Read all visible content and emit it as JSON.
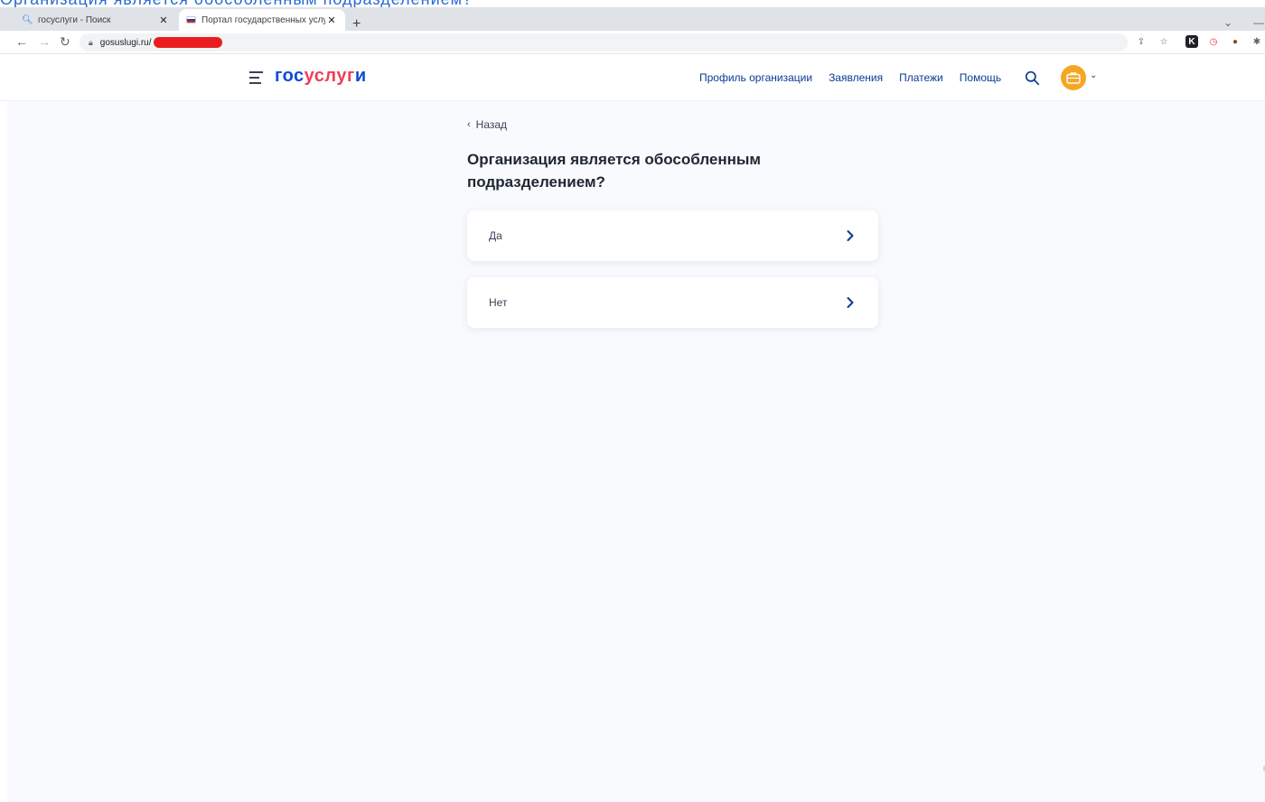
{
  "cropped_header_text": "Организация является обособленным подразделением?",
  "browser": {
    "tabs": [
      {
        "title": "госуслуги - Поиск",
        "icon": "search-icon",
        "active": false
      },
      {
        "title": "Портал государственных услуг",
        "icon": "russian-flag-icon",
        "active": true
      }
    ],
    "url": "gosuslugi.ru/"
  },
  "site": {
    "logo": {
      "part1": "гос",
      "part2": "услуг",
      "part3": "и"
    },
    "nav": [
      "Профиль организации",
      "Заявления",
      "Платежи",
      "Помощь"
    ],
    "avatar_icon": "briefcase-icon",
    "colors": {
      "brand_blue": "#0d4cd3",
      "brand_red": "#ee3f58",
      "avatar_bg": "#f5a623",
      "page_bg": "#f8fafd"
    }
  },
  "main": {
    "back_label": "Назад",
    "question": "Организация является обособленным подразделением?",
    "options": [
      {
        "label": "Да"
      },
      {
        "label": "Нет"
      }
    ]
  }
}
